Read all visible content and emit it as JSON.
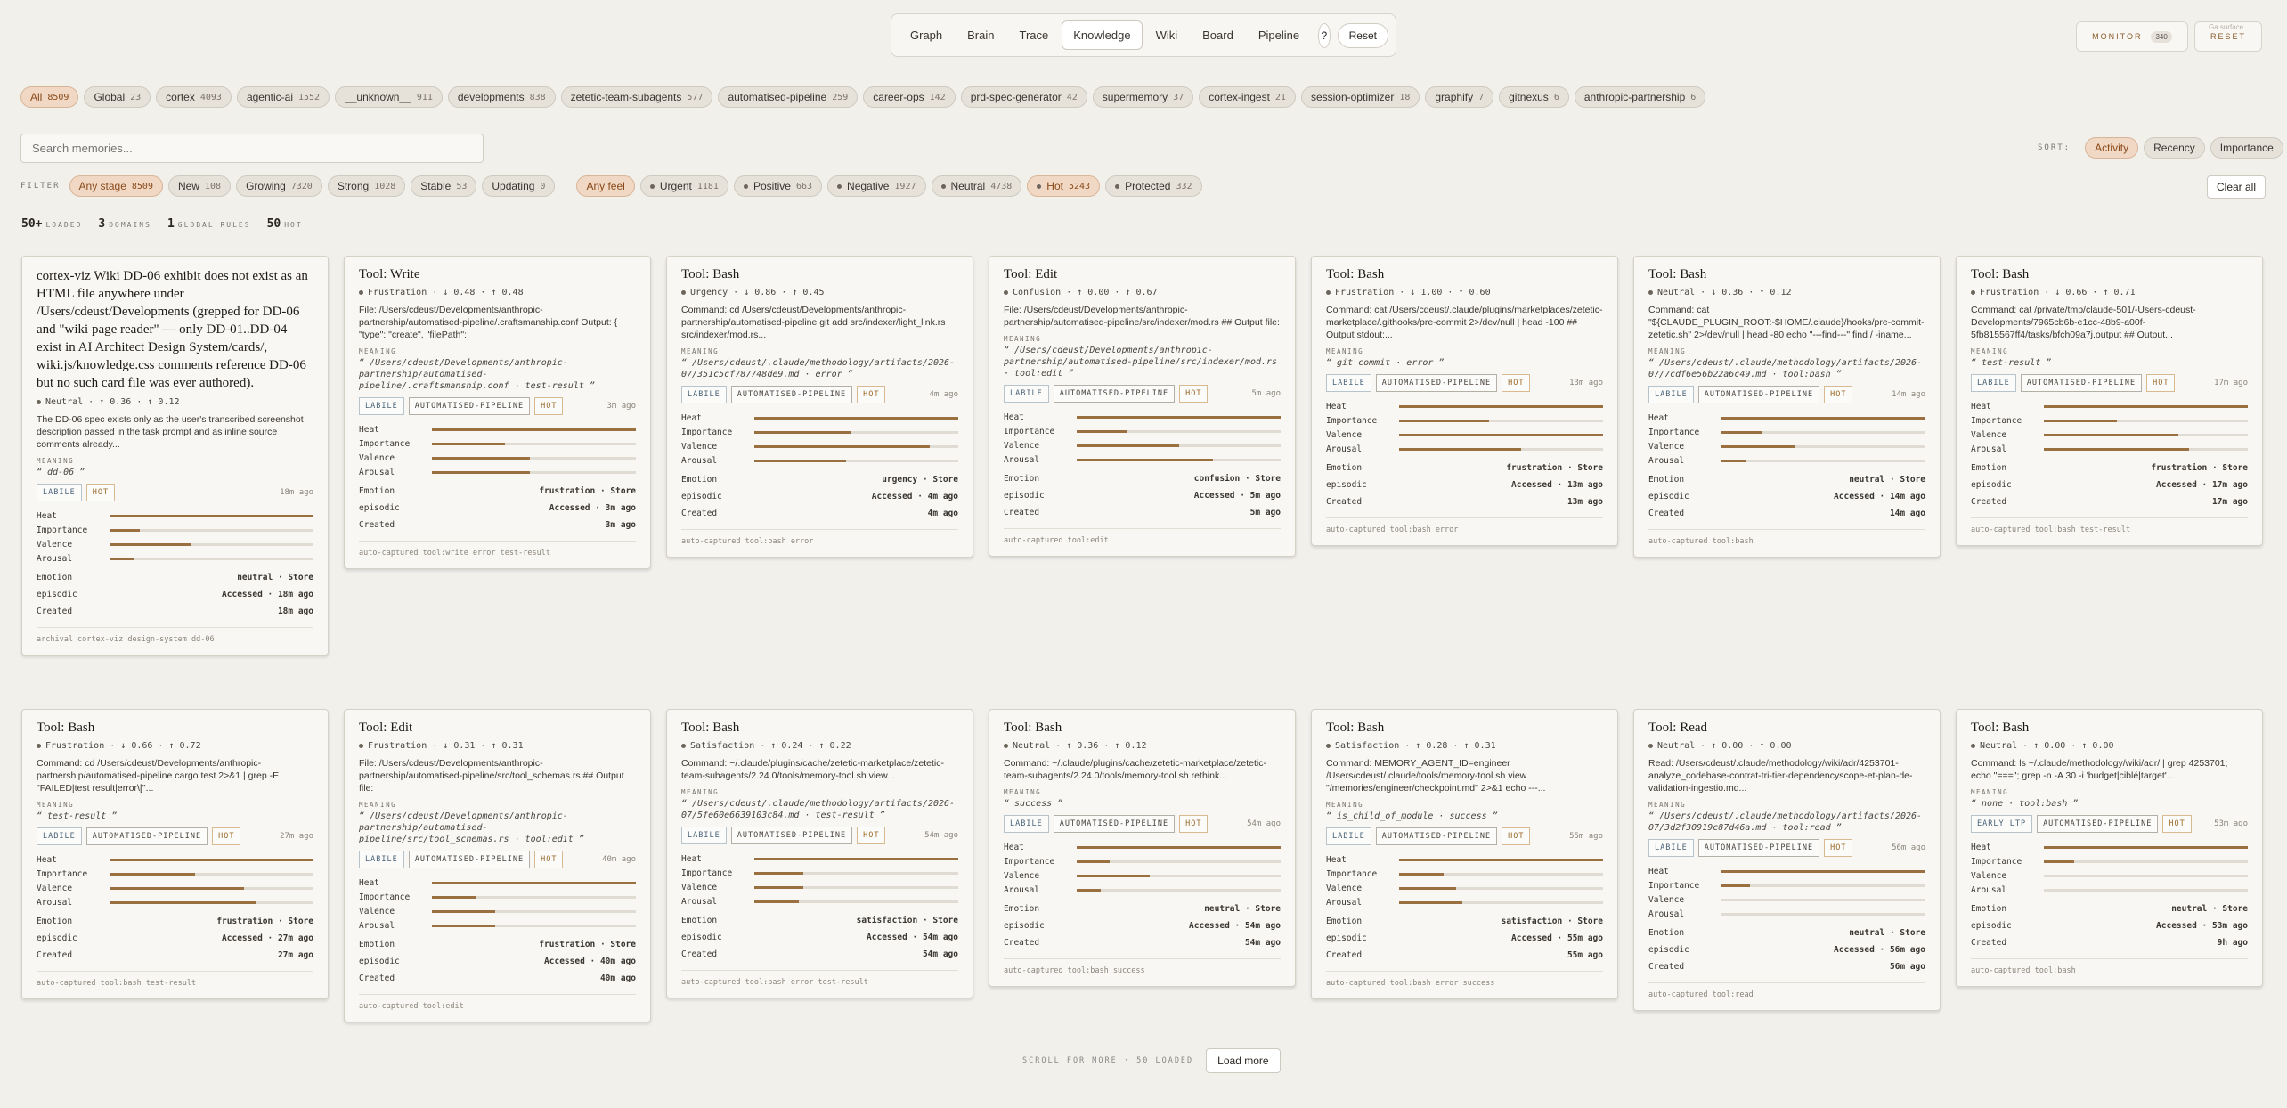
{
  "nav": {
    "tabs": [
      "Graph",
      "Brain",
      "Trace",
      "Knowledge",
      "Wiki",
      "Board",
      "Pipeline"
    ],
    "active": "Knowledge",
    "help": "?",
    "reset": "Reset"
  },
  "monitor": {
    "label": "MONITOR",
    "count": "340"
  },
  "top_reset": "RESET",
  "surface_hint": "Ga surface",
  "domains": [
    {
      "label": "All",
      "count": "8509"
    },
    {
      "label": "Global",
      "count": "23"
    },
    {
      "label": "cortex",
      "count": "4093"
    },
    {
      "label": "agentic-ai",
      "count": "1552"
    },
    {
      "label": "__unknown__",
      "count": "911"
    },
    {
      "label": "developments",
      "count": "838"
    },
    {
      "label": "zetetic-team-subagents",
      "count": "577"
    },
    {
      "label": "automatised-pipeline",
      "count": "259"
    },
    {
      "label": "career-ops",
      "count": "142"
    },
    {
      "label": "prd-spec-generator",
      "count": "42"
    },
    {
      "label": "supermemory",
      "count": "37"
    },
    {
      "label": "cortex-ingest",
      "count": "21"
    },
    {
      "label": "session-optimizer",
      "count": "18"
    },
    {
      "label": "graphify",
      "count": "7"
    },
    {
      "label": "gitnexus",
      "count": "6"
    },
    {
      "label": "anthropic-partnership",
      "count": "6"
    }
  ],
  "search": {
    "placeholder": "Search memories..."
  },
  "sort": {
    "label": "SORT:",
    "options": [
      "Activity",
      "Recency",
      "Importance"
    ],
    "active": "Activity"
  },
  "filter": {
    "label": "FILTER",
    "stages": [
      {
        "label": "Any stage",
        "count": "8509"
      },
      {
        "label": "New",
        "count": "108"
      },
      {
        "label": "Growing",
        "count": "7320"
      },
      {
        "label": "Strong",
        "count": "1028"
      },
      {
        "label": "Stable",
        "count": "53"
      },
      {
        "label": "Updating",
        "count": "0"
      }
    ],
    "feels": [
      {
        "label": "Any feel",
        "count": ""
      },
      {
        "label": "Urgent",
        "count": "1181"
      },
      {
        "label": "Positive",
        "count": "663"
      },
      {
        "label": "Negative",
        "count": "1927"
      },
      {
        "label": "Neutral",
        "count": "4738"
      }
    ],
    "heat": [
      {
        "label": "Hot",
        "count": "5243"
      },
      {
        "label": "Protected",
        "count": "332"
      }
    ],
    "sep": "·",
    "clear": "Clear all"
  },
  "stats": {
    "loaded": "50+",
    "loaded_label": "LOADED",
    "domains": "3",
    "domains_label": "DOMAINS",
    "rules": "1",
    "rules_label": "GLOBAL RULES",
    "hot": "50",
    "hot_label": "HOT"
  },
  "labels": {
    "meaning": "MEANING",
    "heat": "Heat",
    "importance": "Importance",
    "valence": "Valence",
    "arousal": "Arousal",
    "emotion": "Emotion",
    "episodic": "episodic",
    "created": "Created"
  },
  "cards": [
    {
      "title": "cortex-viz Wiki DD-06 exhibit does not exist as an HTML file anywhere under /Users/cdeust/Developments (grepped for DD-06 and \"wiki page reader\" — only DD-01..DD-04 exist in AI Architect Design System/cards/, wiki.js/knowledge.css comments reference DD-06 but no such card file was ever authored).",
      "big": true,
      "emo": "Neutral · ↑ 0.36 · ↑ 0.12",
      "body": "The DD-06 spec exists only as the user's transcribed screenshot description passed in the task prompt and as inline source comments already...",
      "meaning": "“ dd-06 ”",
      "tags": [
        "LABILE",
        "HOT"
      ],
      "ago": "18m ago",
      "heat": 1.0,
      "importance": 0.15,
      "valence": 0.4,
      "arousal": 0.12,
      "emotion": "neutral · Store",
      "episodic": "Accessed · 18m ago",
      "created": "18m ago",
      "foot": "archival cortex-viz design-system dd-06"
    },
    {
      "title": "Tool: Write",
      "emo": "Frustration · ↓ 0.48 · ↑ 0.48",
      "body": "File: /Users/cdeust/Developments/anthropic-partnership/automatised-pipeline/.craftsmanship.conf Output: { \"type\": \"create\", \"filePath\":",
      "meaning": "“ /Users/cdeust/Developments/anthropic-partnership/automatised-pipeline/.craftsmanship.conf · test-result ”",
      "tags": [
        "LABILE",
        "AUTOMATISED-PIPELINE",
        "HOT"
      ],
      "ago": "3m ago",
      "heat": 1.0,
      "importance": 0.36,
      "valence": 0.48,
      "arousal": 0.48,
      "emotion": "frustration · Store",
      "episodic": "Accessed · 3m ago",
      "created": "3m ago",
      "foot": "auto-captured tool:write error test-result"
    },
    {
      "title": "Tool: Bash",
      "emo": "Urgency · ↓ 0.86 · ↑ 0.45",
      "body": "Command: cd /Users/cdeust/Developments/anthropic-partnership/automatised-pipeline git add src/indexer/light_link.rs src/indexer/mod.rs...",
      "meaning": "“ /Users/cdeust/.claude/methodology/artifacts/2026-07/351c5cf787748de9.md · error ”",
      "tags": [
        "LABILE",
        "AUTOMATISED-PIPELINE",
        "HOT"
      ],
      "ago": "4m ago",
      "heat": 1.0,
      "importance": 0.47,
      "valence": 0.86,
      "arousal": 0.45,
      "emotion": "urgency · Store",
      "episodic": "Accessed · 4m ago",
      "created": "4m ago",
      "foot": "auto-captured tool:bash error"
    },
    {
      "title": "Tool: Edit",
      "emo": "Confusion · ↑ 0.00 · ↑ 0.67",
      "body": "File: /Users/cdeust/Developments/anthropic-partnership/automatised-pipeline/src/indexer/mod.rs ## Output file:",
      "meaning": "“ /Users/cdeust/Developments/anthropic-partnership/automatised-pipeline/src/indexer/mod.rs · tool:edit ”",
      "tags": [
        "LABILE",
        "AUTOMATISED-PIPELINE",
        "HOT"
      ],
      "ago": "5m ago",
      "heat": 1.0,
      "importance": 0.25,
      "valence": 0.5,
      "arousal": 0.67,
      "emotion": "confusion · Store",
      "episodic": "Accessed · 5m ago",
      "created": "5m ago",
      "foot": "auto-captured tool:edit"
    },
    {
      "title": "Tool: Bash",
      "emo": "Frustration · ↓ 1.00 · ↑ 0.60",
      "body": "Command: cat /Users/cdeust/.claude/plugins/marketplaces/zetetic-marketplace/.githooks/pre-commit 2>/dev/null | head -100 ## Output stdout:...",
      "meaning": "“ git commit · error ”",
      "tags": [
        "LABILE",
        "AUTOMATISED-PIPELINE",
        "HOT"
      ],
      "ago": "13m ago",
      "heat": 1.0,
      "importance": 0.44,
      "valence": 1.0,
      "arousal": 0.6,
      "emotion": "frustration · Store",
      "episodic": "Accessed · 13m ago",
      "created": "13m ago",
      "foot": "auto-captured tool:bash error"
    },
    {
      "title": "Tool: Bash",
      "emo": "Neutral · ↓ 0.36 · ↑ 0.12",
      "body": "Command: cat \"${CLAUDE_PLUGIN_ROOT:-$HOME/.claude}/hooks/pre-commit-zetetic.sh\" 2>/dev/null | head -80 echo \"---find---\" find / -iname...",
      "meaning": "“ /Users/cdeust/.claude/methodology/artifacts/2026-07/7cdf6e56b22a6c49.md · tool:bash ”",
      "tags": [
        "LABILE",
        "AUTOMATISED-PIPELINE",
        "HOT"
      ],
      "ago": "14m ago",
      "heat": 1.0,
      "importance": 0.2,
      "valence": 0.36,
      "arousal": 0.12,
      "emotion": "neutral · Store",
      "episodic": "Accessed · 14m ago",
      "created": "14m ago",
      "foot": "auto-captured tool:bash"
    },
    {
      "title": "Tool: Bash",
      "emo": "Frustration · ↓ 0.66 · ↑ 0.71",
      "body": "Command: cat /private/tmp/claude-501/-Users-cdeust-Developments/7965cb6b-e1cc-48b9-a00f-5fb815567ff4/tasks/bfch09a7j.output ## Output...",
      "meaning": "“ test-result ”",
      "tags": [
        "LABILE",
        "AUTOMATISED-PIPELINE",
        "HOT"
      ],
      "ago": "17m ago",
      "heat": 1.0,
      "importance": 0.36,
      "valence": 0.66,
      "arousal": 0.71,
      "emotion": "frustration · Store",
      "episodic": "Accessed · 17m ago",
      "created": "17m ago",
      "foot": "auto-captured tool:bash test-result"
    },
    {
      "title": "Tool: Bash",
      "emo": "Frustration · ↓ 0.66 · ↑ 0.72",
      "body": "Command: cd /Users/cdeust/Developments/anthropic-partnership/automatised-pipeline cargo test 2>&1 | grep -E \"FAILED|test result|error\\[\"...",
      "meaning": "“ test-result ”",
      "tags": [
        "LABILE",
        "AUTOMATISED-PIPELINE",
        "HOT"
      ],
      "ago": "27m ago",
      "heat": 1.0,
      "importance": 0.42,
      "valence": 0.66,
      "arousal": 0.72,
      "emotion": "frustration · Store",
      "episodic": "Accessed · 27m ago",
      "created": "27m ago",
      "foot": "auto-captured tool:bash test-result"
    },
    {
      "title": "Tool: Edit",
      "emo": "Frustration · ↓ 0.31 · ↑ 0.31",
      "body": "File: /Users/cdeust/Developments/anthropic-partnership/automatised-pipeline/src/tool_schemas.rs ## Output file:",
      "meaning": "“ /Users/cdeust/Developments/anthropic-partnership/automatised-pipeline/src/tool_schemas.rs · tool:edit ”",
      "tags": [
        "LABILE",
        "AUTOMATISED-PIPELINE",
        "HOT"
      ],
      "ago": "40m ago",
      "heat": 1.0,
      "importance": 0.22,
      "valence": 0.31,
      "arousal": 0.31,
      "emotion": "frustration · Store",
      "episodic": "Accessed · 40m ago",
      "created": "40m ago",
      "foot": "auto-captured tool:edit"
    },
    {
      "title": "Tool: Bash",
      "emo": "Satisfaction · ↑ 0.24 · ↑ 0.22",
      "body": "Command: ~/.claude/plugins/cache/zetetic-marketplace/zetetic-team-subagents/2.24.0/tools/memory-tool.sh view...",
      "meaning": "“ /Users/cdeust/.claude/methodology/artifacts/2026-07/5fe60e6639103c84.md · test-result ”",
      "tags": [
        "LABILE",
        "AUTOMATISED-PIPELINE",
        "HOT"
      ],
      "ago": "54m ago",
      "heat": 1.0,
      "importance": 0.24,
      "valence": 0.24,
      "arousal": 0.22,
      "emotion": "satisfaction · Store",
      "episodic": "Accessed · 54m ago",
      "created": "54m ago",
      "foot": "auto-captured tool:bash error test-result"
    },
    {
      "title": "Tool: Bash",
      "emo": "Neutral · ↑ 0.36 · ↑ 0.12",
      "body": "Command: ~/.claude/plugins/cache/zetetic-marketplace/zetetic-team-subagents/2.24.0/tools/memory-tool.sh rethink...",
      "meaning": "“ success ”",
      "tags": [
        "LABILE",
        "AUTOMATISED-PIPELINE",
        "HOT"
      ],
      "ago": "54m ago",
      "heat": 1.0,
      "importance": 0.16,
      "valence": 0.36,
      "arousal": 0.12,
      "emotion": "neutral · Store",
      "episodic": "Accessed · 54m ago",
      "created": "54m ago",
      "foot": "auto-captured tool:bash success"
    },
    {
      "title": "Tool: Bash",
      "emo": "Satisfaction · ↑ 0.28 · ↑ 0.31",
      "body": "Command: MEMORY_AGENT_ID=engineer /Users/cdeust/.claude/tools/memory-tool.sh view \"/memories/engineer/checkpoint.md\" 2>&1 echo ---...",
      "meaning": "“ is_child_of_module · success ”",
      "tags": [
        "LABILE",
        "AUTOMATISED-PIPELINE",
        "HOT"
      ],
      "ago": "55m ago",
      "heat": 1.0,
      "importance": 0.22,
      "valence": 0.28,
      "arousal": 0.31,
      "emotion": "satisfaction · Store",
      "episodic": "Accessed · 55m ago",
      "created": "55m ago",
      "foot": "auto-captured tool:bash error success"
    },
    {
      "title": "Tool: Read",
      "emo": "Neutral · ↑ 0.00 · ↑ 0.00",
      "body": "Read: /Users/cdeust/.claude/methodology/wiki/adr/4253701-analyze_codebase-contrat-tri-tier-dependencyscope-et-plan-de-validation-ingestio.md...",
      "meaning": "“ /Users/cdeust/.claude/methodology/artifacts/2026-07/3d2f30919c87d46a.md · tool:read ”",
      "tags": [
        "LABILE",
        "AUTOMATISED-PIPELINE",
        "HOT"
      ],
      "ago": "56m ago",
      "heat": 1.0,
      "importance": 0.14,
      "valence": 0.0,
      "arousal": 0.0,
      "emotion": "neutral · Store",
      "episodic": "Accessed · 56m ago",
      "created": "56m ago",
      "foot": "auto-captured tool:read"
    },
    {
      "title": "Tool: Bash",
      "emo": "Neutral · ↑ 0.00 · ↑ 0.00",
      "body": "Command: ls ~/.claude/methodology/wiki/adr/ | grep 4253701; echo \"===\"; grep -n -A 30 -i 'budget|ciblé|target'...",
      "meaning": "“ none · tool:bash ”",
      "tags": [
        "EARLY_LTP",
        "AUTOMATISED-PIPELINE",
        "HOT"
      ],
      "ago": "53m ago",
      "heat": 1.0,
      "importance": 0.15,
      "valence": 0.0,
      "arousal": 0.0,
      "emotion": "neutral · Store",
      "episodic": "Accessed · 53m ago",
      "created": "9h ago",
      "foot": "auto-captured tool:bash"
    }
  ],
  "scroll": {
    "label": "SCROLL FOR MORE · 50 LOADED",
    "load_more": "Load more"
  }
}
